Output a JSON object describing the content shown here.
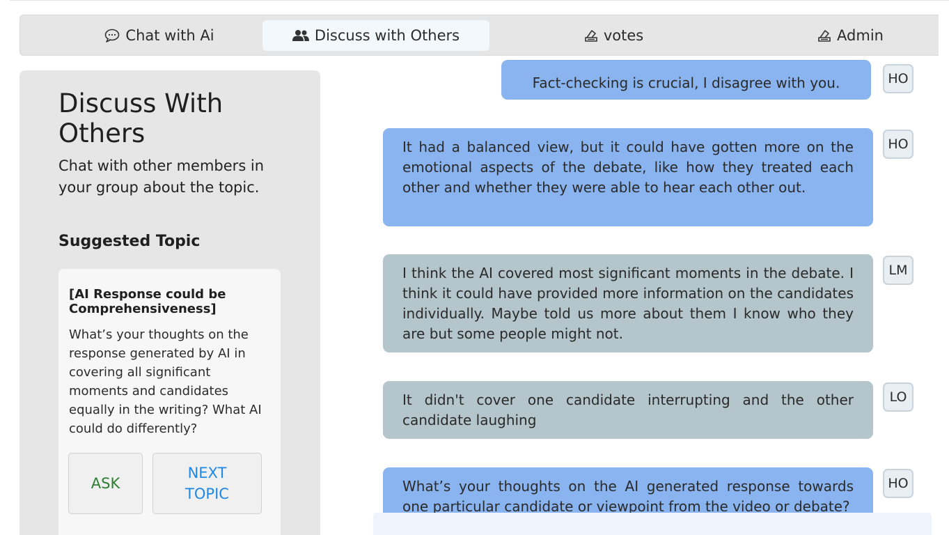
{
  "tabs": [
    {
      "label": "Chat with Ai",
      "icon": "chat-bubble-icon",
      "active": false
    },
    {
      "label": "Discuss with Others",
      "icon": "users-icon",
      "active": true
    },
    {
      "label": "votes",
      "icon": "ballot-box-icon",
      "active": false
    },
    {
      "label": "Admin",
      "icon": "ballot-box-icon",
      "active": false
    }
  ],
  "sidebar": {
    "title": "Discuss With Others",
    "description": "Chat with other members in your group about the topic.",
    "suggested_heading": "Suggested Topic",
    "topic": {
      "title": "[AI Response could be Comprehensiveness]",
      "body": "What’s your thoughts on the response generated by AI in covering all significant moments and candidates equally in the writing? What AI could do differently?",
      "ask_label": "ASK",
      "next_label": "NEXT TOPIC"
    }
  },
  "messages": [
    {
      "text": "Fact-checking is crucial, I disagree with you.",
      "author": "HO",
      "color": "#8ab4ef"
    },
    {
      "text": "It had a balanced view, but it could have gotten more on the emotional aspects of the debate, like how they treated each other and whether they were able to hear each other out.",
      "author": "HO",
      "color": "#8ab4ef"
    },
    {
      "text": "I think the AI covered most significant moments in the debate. I think it could have provided more information on the candidates individually. Maybe told us more about them I know who they are but some people might not.",
      "author": "LM",
      "color": "#b4c5cb"
    },
    {
      "text": "It didn't cover one candidate interrupting and the other candidate laughing",
      "author": "LO",
      "color": "#b4c5cb"
    },
    {
      "text": "What’s your thoughts on the AI generated response towards one particular candidate or viewpoint from the video or debate?",
      "author": "HO",
      "color": "#8ab4ef"
    }
  ]
}
